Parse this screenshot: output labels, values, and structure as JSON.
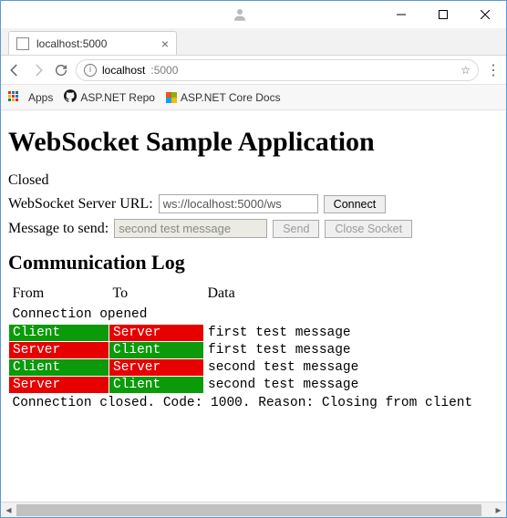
{
  "window": {
    "tab_title": "localhost:5000",
    "url_strong": "localhost",
    "url_rest": ":5000"
  },
  "bookmarks": {
    "apps": "Apps",
    "gh": "ASP.NET Repo",
    "ms": "ASP.NET Core Docs"
  },
  "page": {
    "h1": "WebSocket Sample Application",
    "state": "Closed",
    "url_label": "WebSocket Server URL:",
    "url_value": "ws://localhost:5000/ws",
    "connect": "Connect",
    "msg_label": "Message to send:",
    "msg_value": "second test message",
    "send": "Send",
    "close": "Close Socket",
    "h2": "Communication Log",
    "headers": {
      "from": "From",
      "to": "To",
      "data": "Data"
    },
    "rows": [
      {
        "type": "full",
        "text": "Connection opened"
      },
      {
        "type": "msg",
        "from": "Client",
        "to": "Server",
        "data": "first test message"
      },
      {
        "type": "msg",
        "from": "Server",
        "to": "Client",
        "data": "first test message"
      },
      {
        "type": "msg",
        "from": "Client",
        "to": "Server",
        "data": "second test message"
      },
      {
        "type": "msg",
        "from": "Server",
        "to": "Client",
        "data": "second test message"
      },
      {
        "type": "full",
        "text": "Connection closed. Code: 1000. Reason: Closing from client"
      }
    ]
  }
}
